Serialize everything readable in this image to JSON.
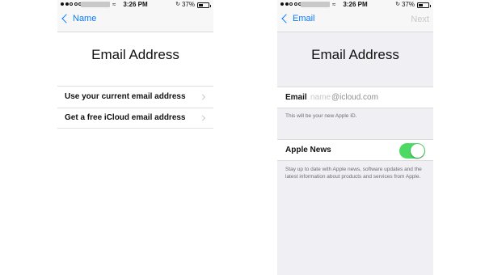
{
  "status_bar": {
    "time": "3:26 PM",
    "battery_percent": "37%",
    "battery_level": 0.37,
    "signal_dots_filled": 2,
    "signal_dots_total": 5,
    "wifi_icon": "wifi-icon",
    "rotation_lock_icon": "rotation-lock-icon"
  },
  "left_screen": {
    "back_label": "Name",
    "title": "Email Address",
    "options": [
      {
        "label": "Use your current email address"
      },
      {
        "label": "Get a free iCloud email address"
      }
    ]
  },
  "right_screen": {
    "back_label": "Email",
    "next_label": "Next",
    "title": "Email Address",
    "email_label": "Email",
    "email_placeholder": "name",
    "email_suffix": "@icloud.com",
    "email_hint": "This will be your new Apple ID.",
    "apple_news_label": "Apple News",
    "apple_news_on": true,
    "apple_news_description": "Stay up to date with Apple news, software updates and the latest information about products and services from Apple."
  },
  "colors": {
    "accent": "#0a7bff",
    "toggle_on": "#4cd964",
    "disabled": "#c7c7cc"
  }
}
